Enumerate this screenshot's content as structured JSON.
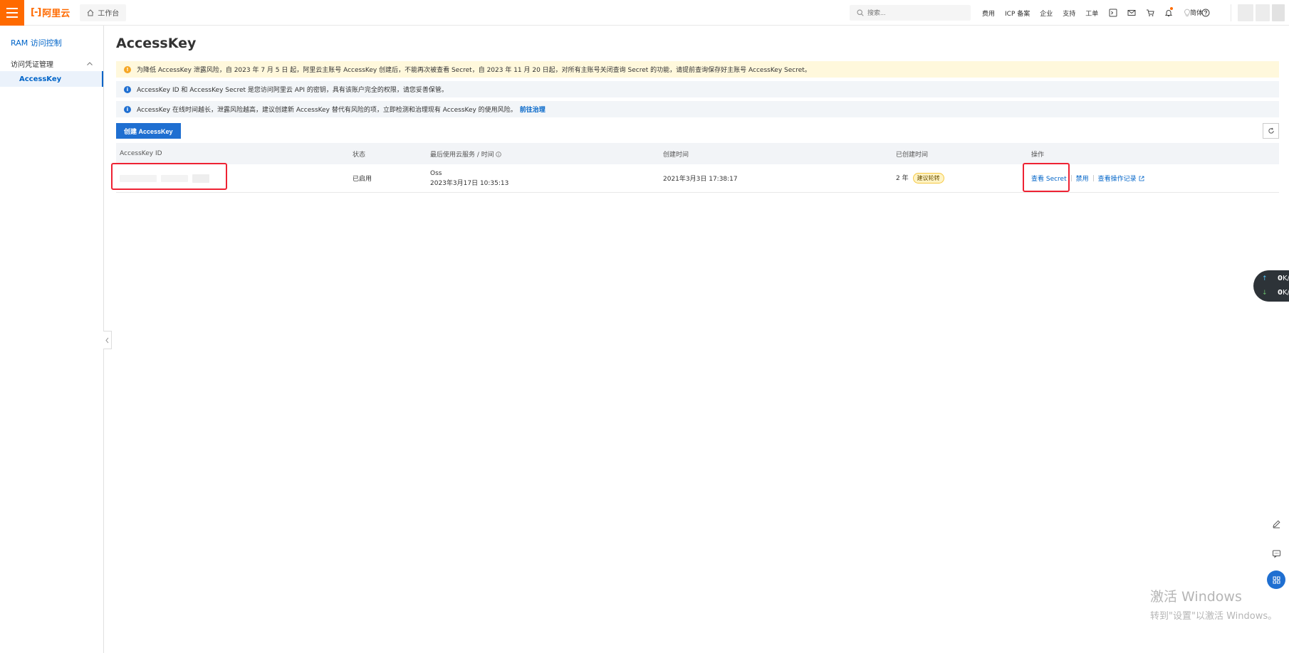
{
  "topbar": {
    "logo_text": "阿里云",
    "workbench_label": "工作台",
    "search_placeholder": "搜索...",
    "nav_links": [
      "费用",
      "ICP 备案",
      "企业",
      "支持",
      "工单"
    ],
    "lang_label": "简体"
  },
  "sidebar": {
    "title": "RAM 访问控制",
    "group_label": "访问凭证管理",
    "active_item": "AccessKey"
  },
  "main": {
    "page_title": "AccessKey",
    "notices": {
      "warn": "为降低 AccessKey 泄露风险，自 2023 年 7 月 5 日 起，阿里云主账号 AccessKey 创建后，不能再次被查看 Secret，自 2023 年 11 月 20 日起，对所有主账号关闭查询 Secret 的功能，请提前查询保存好主账号 AccessKey Secret。",
      "info1": "AccessKey ID 和 AccessKey Secret 是您访问阿里云 API 的密钥，具有该账户完全的权限，请您妥善保管。",
      "info2": "AccessKey 在线时间越长，泄露风险越高，建议创建新 AccessKey 替代有风险的项，立即检测和治理现有 AccessKey 的使用风险。",
      "info2_link": "前往治理"
    },
    "create_button": "创建 AccessKey",
    "table": {
      "headers": [
        "AccessKey ID",
        "状态",
        "最后使用云服务 / 时间",
        "创建时间",
        "已创建时间",
        "操作"
      ],
      "row": {
        "status": "已启用",
        "last_service": "Oss",
        "last_time": "2023年3月17日 10:35:13",
        "created_at": "2021年3月3日 17:38:17",
        "age": "2 年",
        "age_badge": "建议轮转",
        "op_view_secret": "查看 Secret",
        "op_disable": "禁用",
        "op_logs": "查看操作记录"
      }
    }
  },
  "speed": {
    "up_value": "0",
    "up_unit": "K/s",
    "down_value": "0",
    "down_unit": "K/s"
  },
  "watermark": {
    "line1": "激活 Windows",
    "line2": "转到\"设置\"以激活 Windows。"
  },
  "colors": {
    "brand": "#ff6a00",
    "link": "#0064c8",
    "primary": "#1f6fd1",
    "highlight": "#ee2233"
  }
}
